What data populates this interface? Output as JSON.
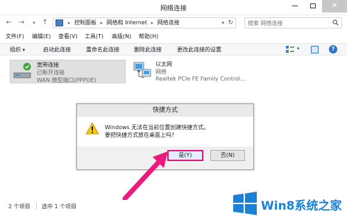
{
  "window": {
    "title": "网络连接"
  },
  "address": {
    "crumbs": [
      "控制面板",
      "网络和 Internet",
      "网络连接"
    ],
    "search_placeholder": "搜索 网络连接"
  },
  "menu": [
    "文件(F)",
    "编辑(E)",
    "查看(V)",
    "工具(T)",
    "高级(N)",
    "帮助(H)"
  ],
  "commands": [
    "组织",
    "启动此连接",
    "重命名此连接",
    "删除此连接",
    "更改此连接的设置"
  ],
  "connections": [
    {
      "name": "宽带连接",
      "status": "已断开连接",
      "device": "WAN 微型端口(PPPOE)"
    },
    {
      "name": "以太网",
      "status": "网络",
      "device": "Realtek PCIe FE Family Control..."
    }
  ],
  "dialog": {
    "title": "快捷方式",
    "line1": "Windows 无法在当前位置创建快捷方式。",
    "line2": "要把快捷方式放在桌面上吗?",
    "yes": "是(Y)",
    "no": "否(N)"
  },
  "statusbar": {
    "count": "2 个项目",
    "selected": "选中 1 个项目"
  },
  "watermark": {
    "text": "Win8系统之家"
  },
  "colors": {
    "accent_highlight": "#e5127a",
    "selected_bg": "#e0e0e0",
    "watermark_blue": "#1c80d4"
  }
}
